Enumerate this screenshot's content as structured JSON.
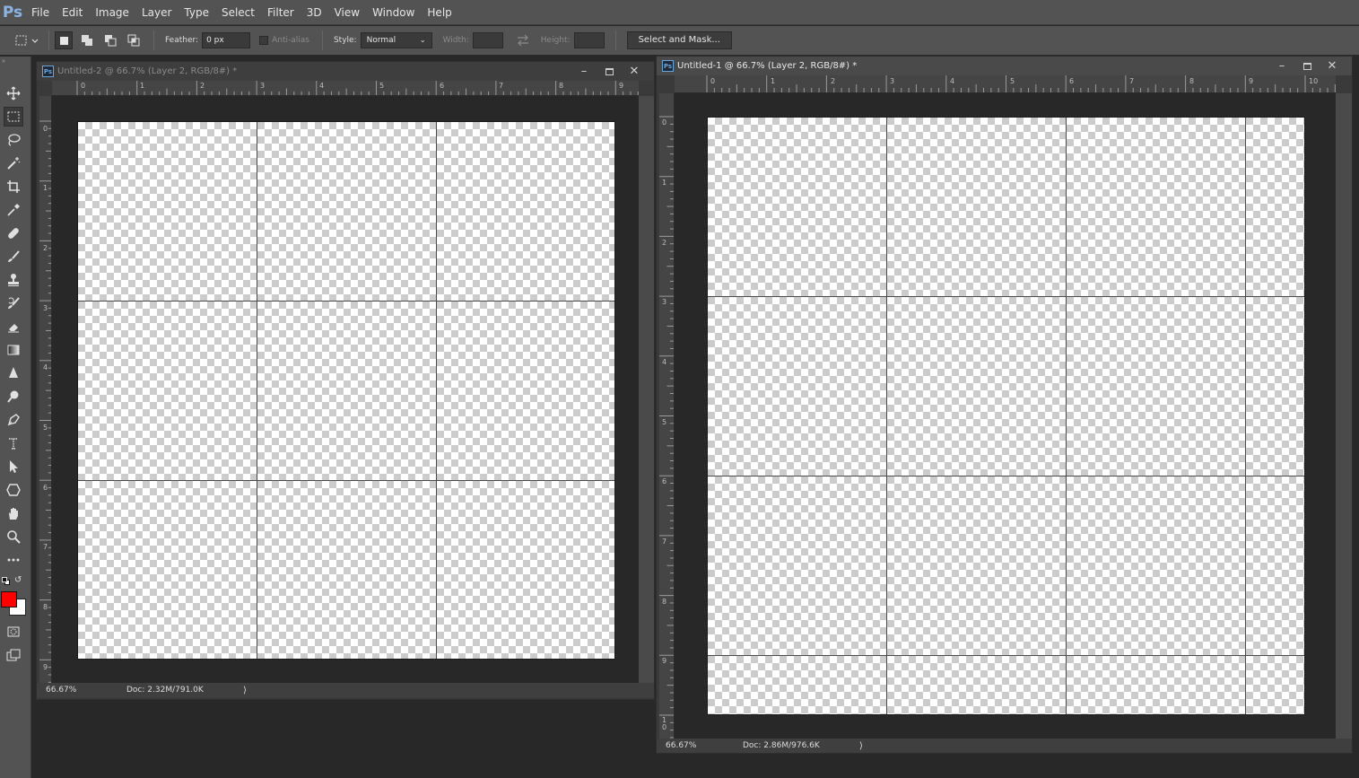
{
  "app": {
    "logo": "Ps"
  },
  "menu": [
    "File",
    "Edit",
    "Image",
    "Layer",
    "Type",
    "Select",
    "Filter",
    "3D",
    "View",
    "Window",
    "Help"
  ],
  "options": {
    "feather_label": "Feather:",
    "feather_value": "0 px",
    "antialias_label": "Anti-alias",
    "style_label": "Style:",
    "style_value": "Normal",
    "width_label": "Width:",
    "height_label": "Height:",
    "select_mask_label": "Select and Mask..."
  },
  "tools": [
    "move-tool",
    "rectangular-marquee-tool",
    "lasso-tool",
    "magic-wand-tool",
    "crop-tool",
    "eyedropper-tool",
    "healing-brush-tool",
    "brush-tool",
    "clone-stamp-tool",
    "history-brush-tool",
    "eraser-tool",
    "gradient-tool",
    "blur-tool",
    "dodge-tool",
    "pen-tool",
    "type-tool",
    "path-selection-tool",
    "shape-tool",
    "hand-tool",
    "zoom-tool",
    "more-tools"
  ],
  "colors": {
    "foreground": "#ff0000",
    "background": "#ffffff"
  },
  "doc2": {
    "title": "Untitled-2 @ 66.7% (Layer 2, RGB/8#) *",
    "zoom": "66.67%",
    "doc_info": "Doc: 2.32M/791.0K",
    "ruler_h": [
      "0",
      "1",
      "2",
      "3",
      "4",
      "5",
      "6",
      "7",
      "8",
      "9"
    ],
    "ruler_v": [
      "0",
      "1",
      "2",
      "3",
      "4",
      "5",
      "6",
      "7",
      "8",
      "9"
    ]
  },
  "doc1": {
    "title": "Untitled-1 @ 66.7% (Layer 2, RGB/8#) *",
    "zoom": "66.67%",
    "doc_info": "Doc: 2.86M/976.6K",
    "ruler_h": [
      "0",
      "1",
      "2",
      "3",
      "4",
      "5",
      "6",
      "7",
      "8",
      "9",
      "10"
    ],
    "ruler_v": [
      "0",
      "1",
      "2",
      "3",
      "4",
      "5",
      "6",
      "7",
      "8",
      "9",
      "1 0"
    ]
  }
}
